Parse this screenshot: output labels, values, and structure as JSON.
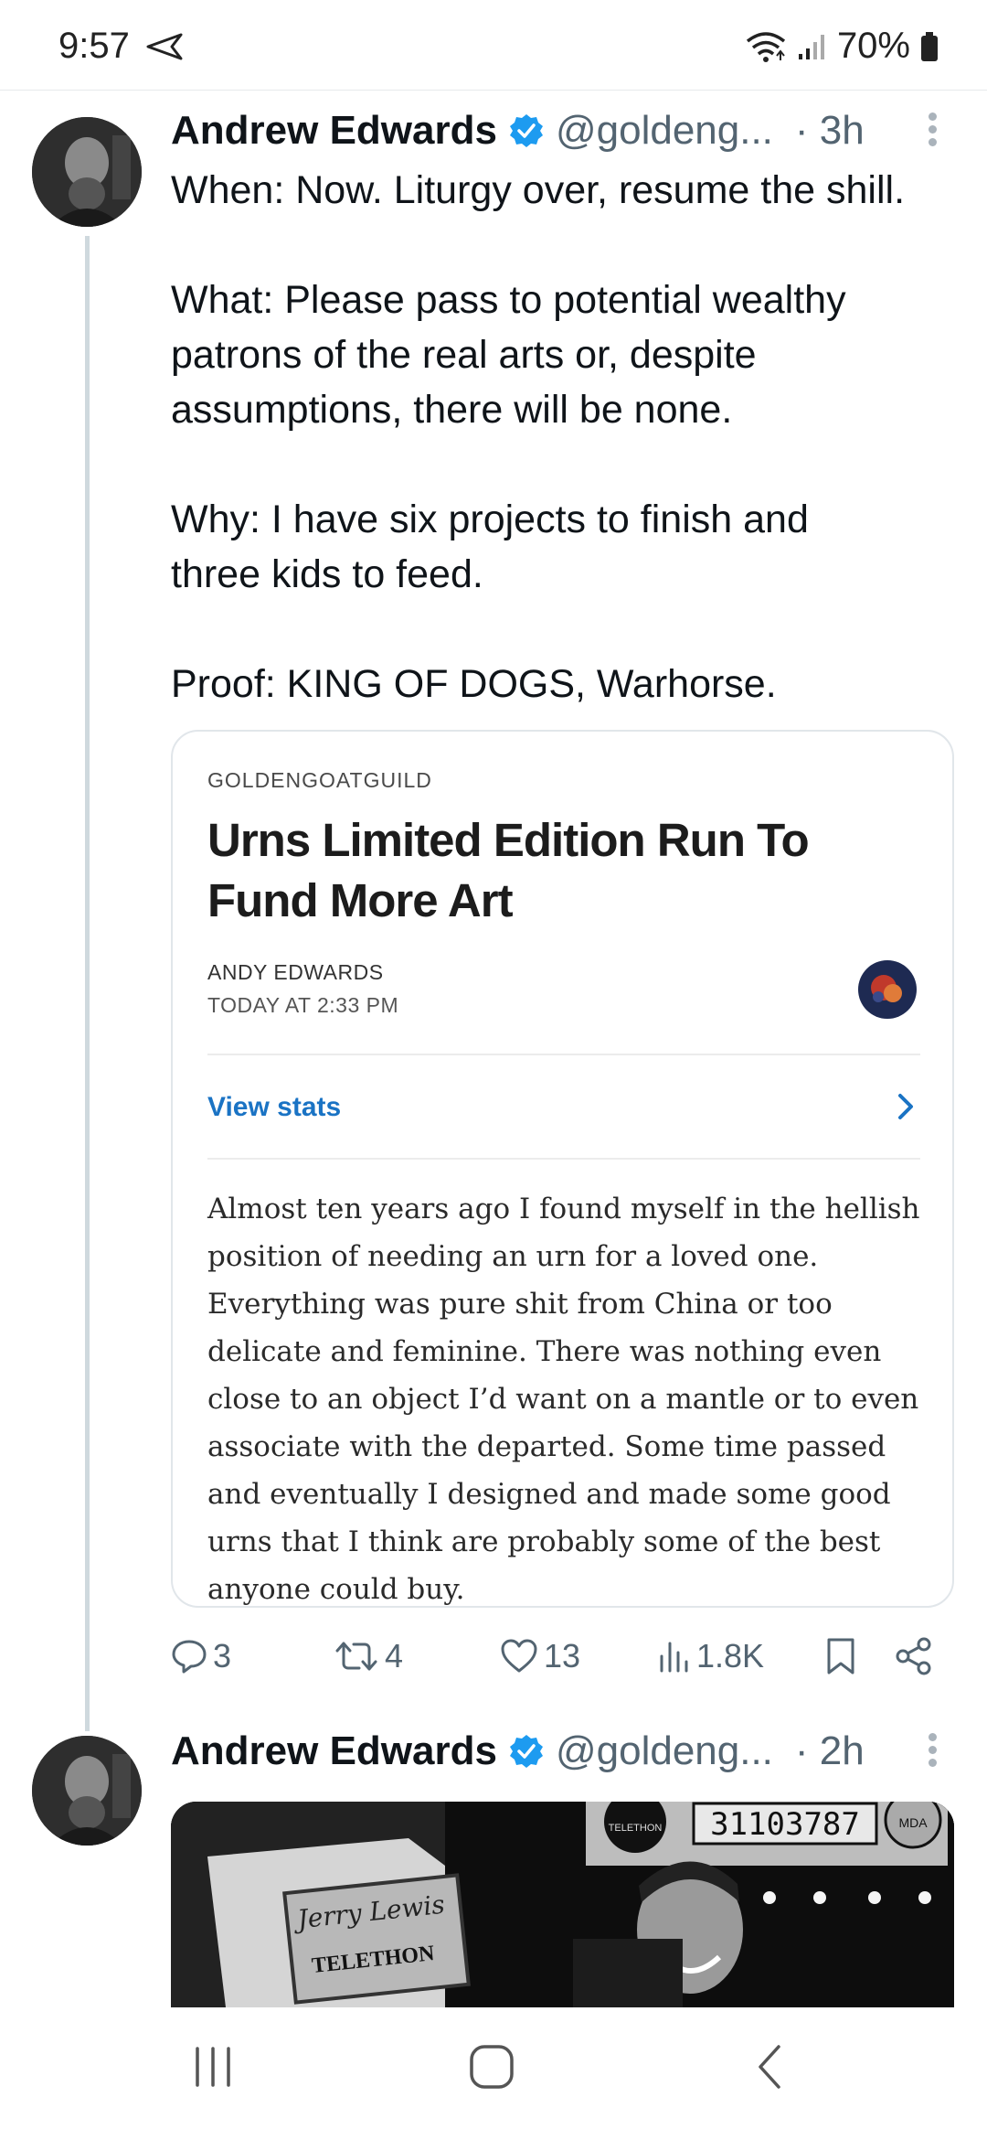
{
  "status_bar": {
    "time": "9:57",
    "battery": "70%"
  },
  "tweet1": {
    "name": "Andrew Edwards",
    "handle": "@goldeng...",
    "time": "· 3h",
    "text_lines": [
      "When: Now. Liturgy over, resume the shill.",
      "",
      "What: Please pass to potential wealthy",
      "patrons of the real arts or, despite",
      "assumptions, there will be none.",
      "",
      "Why: I have six projects to finish and",
      "three kids to feed.",
      "",
      "Proof: KING OF DOGS, Warhorse."
    ],
    "card": {
      "source": "GOLDENGOATGUILD",
      "title": "Urns Limited Edition Run To Fund More Art",
      "author": "ANDY EDWARDS",
      "date": "TODAY AT 2:33 PM",
      "stats_label": "View stats",
      "body": "Almost ten years ago I found myself in the hellish position of needing an urn for a loved one. Everything was pure shit from China or too delicate and feminine. There was nothing even close to an object I’d want on a mantle or to even associate with the departed. Some time passed and eventually I designed and made some good urns that I think are probably some of the best anyone could buy."
    },
    "actions": {
      "replies": "3",
      "retweets": "4",
      "likes": "13",
      "views": "1.8K"
    }
  },
  "tweet2": {
    "name": "Andrew Edwards",
    "handle": "@goldeng...",
    "time": "· 2h",
    "media_text": {
      "telethon_label": "TELETHON",
      "sign_brand": "Jerry Lewis",
      "sign_label": "TELETHON",
      "counter": "31103787",
      "badge": "MDA"
    }
  },
  "colors": {
    "verified": "#1d9bf0",
    "link": "#1a73c4",
    "muted": "#536471"
  }
}
